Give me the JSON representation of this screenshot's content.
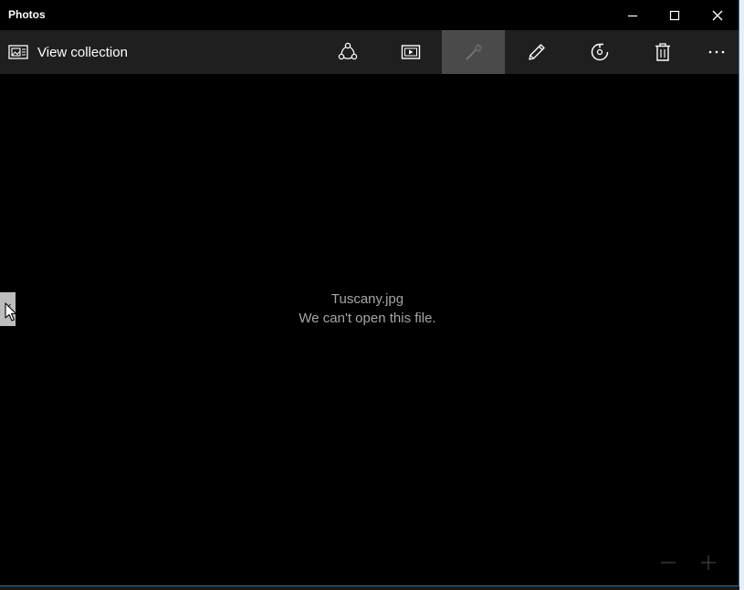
{
  "window": {
    "title": "Photos"
  },
  "title_buttons": {
    "minimize_icon": "minimize-icon",
    "maximize_icon": "maximize-icon",
    "close_icon": "close-icon"
  },
  "toolbar": {
    "view_collection_label": "View collection",
    "buttons": [
      {
        "icon": "share-icon",
        "active": false
      },
      {
        "icon": "slideshow-icon",
        "active": false
      },
      {
        "icon": "enhance-icon",
        "active": true
      },
      {
        "icon": "edit-icon",
        "active": false
      },
      {
        "icon": "rotate-icon",
        "active": false
      },
      {
        "icon": "delete-icon",
        "active": false
      },
      {
        "icon": "more-icon",
        "active": false
      }
    ]
  },
  "content": {
    "filename": "Tuscany.jpg",
    "error_message": "We can't open this file."
  },
  "colors": {
    "background": "#000000",
    "toolbar": "#1f1f1f",
    "active_button": "#4a4a4a",
    "message_text": "#a6a6a6",
    "window_border": "#3a6ea5"
  }
}
